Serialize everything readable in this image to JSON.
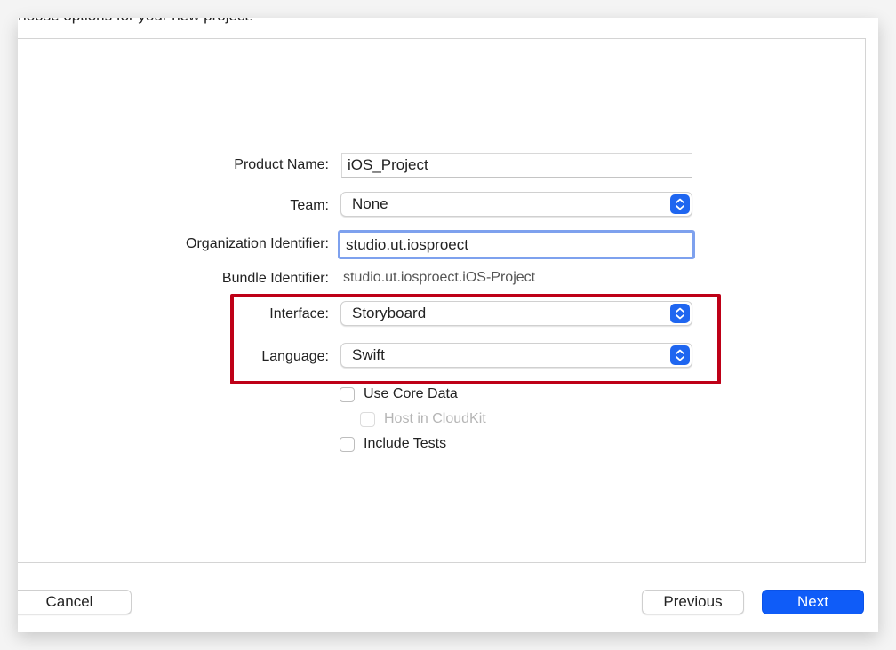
{
  "header": {
    "title": "Choose options for your new project:"
  },
  "form": {
    "product_name": {
      "label": "Product Name:",
      "value": "iOS_Project"
    },
    "team": {
      "label": "Team:",
      "value": "None"
    },
    "organization_identifier": {
      "label": "Organization Identifier:",
      "value": "studio.ut.iosproect"
    },
    "bundle_identifier": {
      "label": "Bundle Identifier:",
      "value": "studio.ut.iosproect.iOS-Project"
    },
    "interface": {
      "label": "Interface:",
      "value": "Storyboard"
    },
    "language": {
      "label": "Language:",
      "value": "Swift"
    },
    "use_core_data": {
      "label": "Use Core Data",
      "checked": false
    },
    "host_in_cloudkit": {
      "label": "Host in CloudKit",
      "checked": false,
      "disabled": true
    },
    "include_tests": {
      "label": "Include Tests",
      "checked": false
    }
  },
  "footer": {
    "cancel": "Cancel",
    "previous": "Previous",
    "next": "Next"
  },
  "colors": {
    "accent": "#0f5cf8",
    "highlight": "#be0017",
    "focus_ring": "#7ea1ee"
  }
}
